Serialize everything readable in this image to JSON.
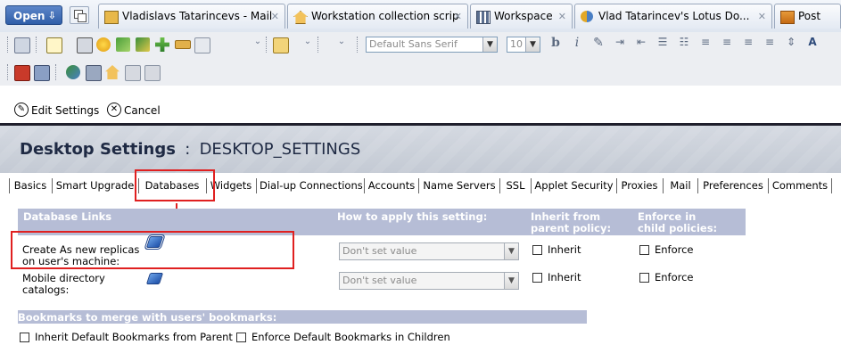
{
  "tabstrip": {
    "open_label": "Open",
    "tabs": [
      {
        "label": "Vladislavs Tatarincevs - Mail",
        "icon": "mail-icon"
      },
      {
        "label": "Workstation collection scrip",
        "icon": "home-icon"
      },
      {
        "label": "Workspace",
        "icon": "workspace-icon"
      },
      {
        "label": "Vlad Tatarincev's Lotus Do...",
        "icon": "lotus-document-icon"
      },
      {
        "label": "Post",
        "icon": "post-icon"
      }
    ],
    "close_glyph": "✕"
  },
  "toolbar": {
    "font_name": "Default Sans Serif",
    "font_size": "10",
    "bold_glyph": "b",
    "italic_glyph": "i"
  },
  "actions": {
    "edit_label": "Edit Settings",
    "cancel_label": "Cancel"
  },
  "header": {
    "title": "Desktop Settings",
    "separator": ":",
    "subtitle": "DESKTOP_SETTINGS"
  },
  "settings_tabs": [
    "Basics",
    "Smart Upgrade",
    "Databases",
    "Widgets",
    "Dial-up Connections",
    "Accounts",
    "Name Servers",
    "SSL",
    "Applet Security",
    "Proxies",
    "Mail",
    "Preferences",
    "Comments"
  ],
  "active_tab": "Databases",
  "database_links": {
    "section_title": "Database Links",
    "col_apply": "How to apply this setting:",
    "col_inherit_1": "Inherit from",
    "col_inherit_2": "parent policy:",
    "col_enforce_1": "Enforce in",
    "col_enforce_2": "child policies:",
    "rows": [
      {
        "label_1": "Create As new replicas",
        "label_2": "on user's machine:",
        "apply_value": "Don't set value",
        "inherit_label": "Inherit",
        "enforce_label": "Enforce"
      },
      {
        "label_1": "Mobile directory",
        "label_2": "catalogs:",
        "apply_value": "Don't set value",
        "inherit_label": "Inherit",
        "enforce_label": "Enforce"
      }
    ]
  },
  "bookmarks": {
    "section_title": "Bookmarks to merge with users' bookmarks:",
    "inherit_label": "Inherit Default Bookmarks from Parent",
    "enforce_label": "Enforce Default Bookmarks in Children"
  },
  "colors": {
    "section_header": "#b6bdd6",
    "annotation_red": "#e02020",
    "title_text": "#1f2a44"
  }
}
